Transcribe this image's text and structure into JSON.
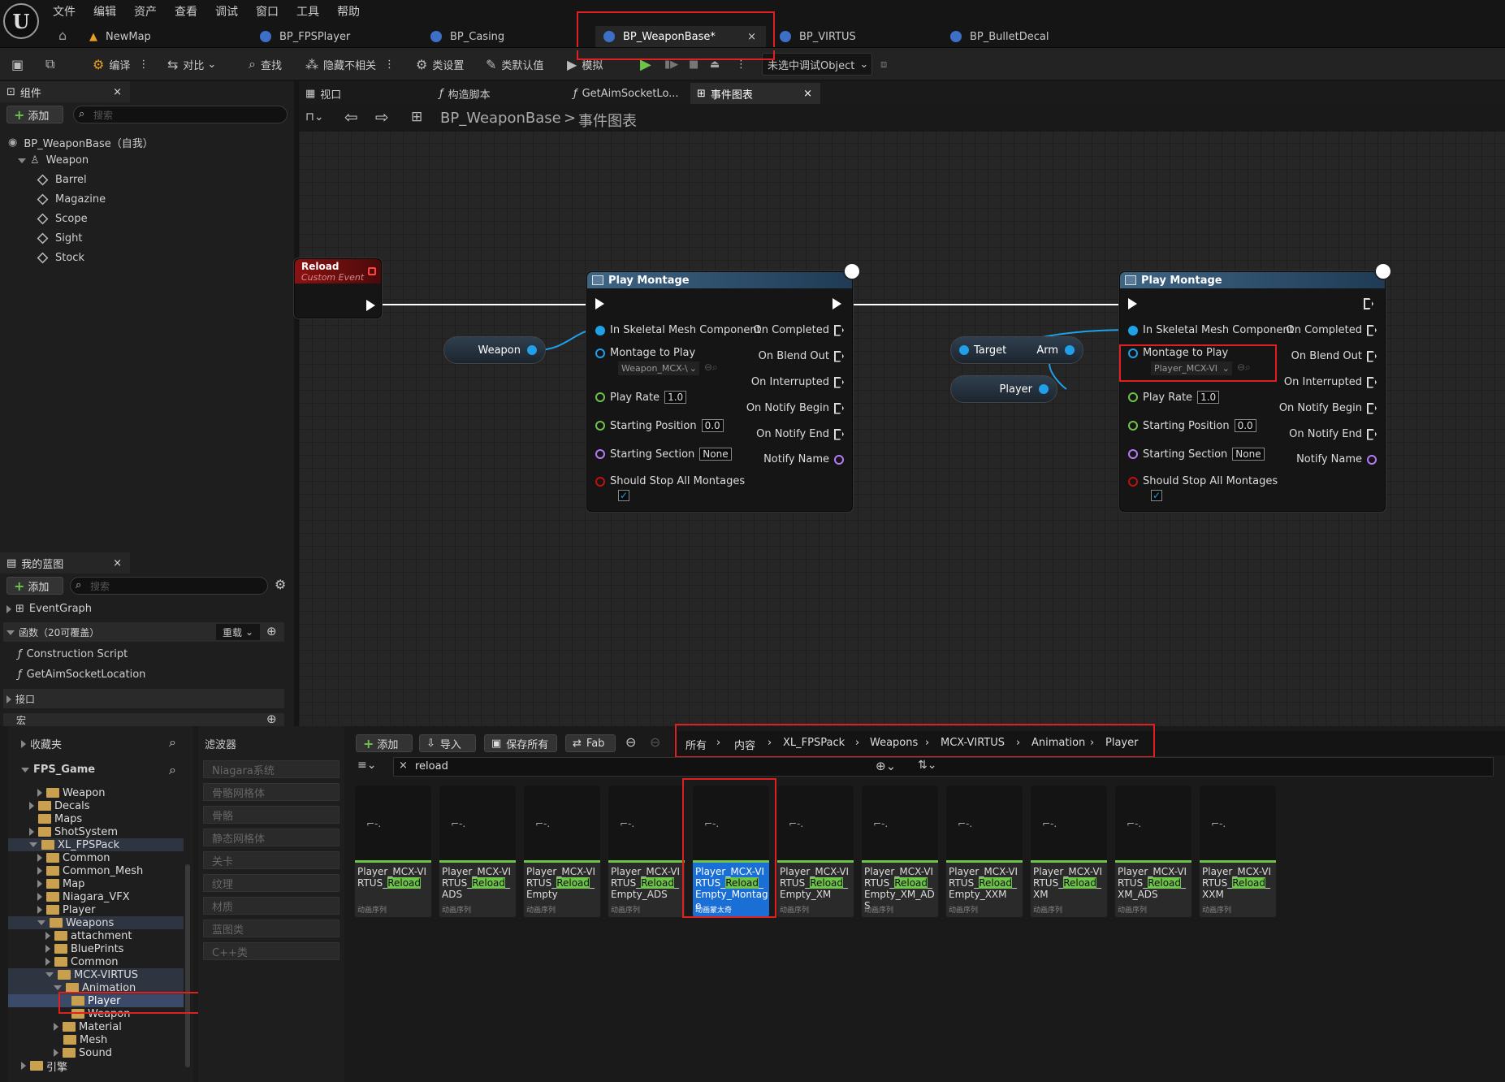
{
  "menu": [
    "文件",
    "编辑",
    "资产",
    "查看",
    "调试",
    "窗口",
    "工具",
    "帮助"
  ],
  "doc_tabs": [
    "NewMap",
    "BP_FPSPlayer",
    "BP_Casing",
    "BP_WeaponBase*",
    "BP_VIRTUS",
    "BP_BulletDecal"
  ],
  "toolbar": {
    "compile": "编译",
    "diff": "对比",
    "find": "查找",
    "hide_unrelated": "隐藏不相关",
    "class_settings": "类设置",
    "class_defaults": "类默认值",
    "simulate": "模拟",
    "debug_object": "未选中调试Object"
  },
  "components": {
    "tab": "组件",
    "add": "添加",
    "search_placeholder": "搜索",
    "root": "BP_WeaponBase（自我）",
    "weapon": "Weapon",
    "children": [
      "Barrel",
      "Magazine",
      "Scope",
      "Sight",
      "Stock"
    ]
  },
  "graph_tabs": [
    "视口",
    "构造脚本",
    "GetAimSocketLo...",
    "事件图表"
  ],
  "graph_breadcrumb": {
    "bp": "BP_WeaponBase",
    "sep": ">",
    "graph": "事件图表"
  },
  "event_node": {
    "title": "Reload",
    "subtitle": "Custom Event"
  },
  "play_montage_1": {
    "title": "Play Montage",
    "inputs": {
      "mesh": "In Skeletal Mesh Component",
      "montage": "Montage to Play",
      "montage_value": "Weapon_MCX-\\",
      "rate": "Play Rate",
      "rate_value": "1.0",
      "start_pos": "Starting Position",
      "start_pos_value": "0.0",
      "start_section": "Starting Section",
      "start_section_value": "None",
      "stop_all": "Should Stop All Montages"
    },
    "outputs": [
      "On Completed",
      "On Blend Out",
      "On Interrupted",
      "On Notify Begin",
      "On Notify End",
      "Notify Name"
    ]
  },
  "play_montage_2": {
    "title": "Play Montage",
    "inputs": {
      "mesh": "In Skeletal Mesh Component",
      "montage": "Montage to Play",
      "montage_value": "Player_MCX-VI",
      "rate": "Play Rate",
      "rate_value": "1.0",
      "start_pos": "Starting Position",
      "start_pos_value": "0.0",
      "start_section": "Starting Section",
      "start_section_value": "None",
      "stop_all": "Should Stop All Montages"
    },
    "outputs": [
      "On Completed",
      "On Blend Out",
      "On Interrupted",
      "On Notify Begin",
      "On Notify End",
      "Notify Name"
    ]
  },
  "var_nodes": {
    "weapon": "Weapon",
    "target": "Target",
    "arm": "Arm",
    "player": "Player"
  },
  "my_blueprint": {
    "tab": "我的蓝图",
    "add": "添加",
    "search_placeholder": "搜索",
    "event_graph": "EventGraph",
    "functions_header": "函数（20可覆盖）",
    "override": "重载",
    "functions": [
      "Construction Script",
      "GetAimSocketLocation"
    ],
    "interfaces": "接口",
    "macros": "宏"
  },
  "content_browser": {
    "favorites": "收藏夹",
    "project": "FPS_Game",
    "filters": "滤波器",
    "filter_items": [
      "Niagara系统",
      "骨骼网格体",
      "骨骼",
      "静态网格体",
      "关卡",
      "纹理",
      "材质",
      "蓝图类",
      "C++类"
    ],
    "folders": [
      "Weapon",
      "Decals",
      "Maps",
      "ShotSystem",
      "XL_FPSPack",
      "Common",
      "Common_Mesh",
      "Map",
      "Niagara_VFX",
      "Player",
      "Weapons",
      "attachment",
      "BluePrints",
      "Common",
      "MCX-VIRTUS",
      "Animation",
      "Player",
      "Weapon",
      "Material",
      "Mesh",
      "Sound",
      "引擎"
    ],
    "add": "添加",
    "import": "导入",
    "save_all": "保存所有",
    "fab": "Fab",
    "path": [
      "所有",
      "内容",
      "XL_FPSPack",
      "Weapons",
      "MCX-VIRTUS",
      "Animation",
      "Player"
    ],
    "search_value": "reload",
    "assets": [
      {
        "a": "Player_MCX-VIRTUS_",
        "hl": "Reload",
        "b": "",
        "type": "动画序列"
      },
      {
        "a": "Player_MCX-VIRTUS_",
        "hl": "Reload",
        "b": "_ADS",
        "type": "动画序列"
      },
      {
        "a": "Player_MCX-VIRTUS_",
        "hl": "Reload",
        "b": "_Empty",
        "type": "动画序列"
      },
      {
        "a": "Player_MCX-VIRTUS_",
        "hl": "Reload",
        "b": "_Empty_ADS",
        "type": "动画序列"
      },
      {
        "a": "Player_MCX-VIRTUS_",
        "hl": "Reload",
        "b": "_Empty_Montage",
        "type": "动画蒙太奇"
      },
      {
        "a": "Player_MCX-VIRTUS_",
        "hl": "Reload",
        "b": "_Empty_XM",
        "type": "动画序列"
      },
      {
        "a": "Player_MCX-VIRTUS_",
        "hl": "Reload",
        "b": "_Empty_XM_ADS",
        "type": "动画序列"
      },
      {
        "a": "Player_MCX-VIRTUS_",
        "hl": "Reload",
        "b": "_Empty_XXM",
        "type": "动画序列"
      },
      {
        "a": "Player_MCX-VIRTUS_",
        "hl": "Reload",
        "b": "_XM",
        "type": "动画序列"
      },
      {
        "a": "Player_MCX-VIRTUS_",
        "hl": "Reload",
        "b": "_XM_ADS",
        "type": "动画序列"
      },
      {
        "a": "Player_MCX-VIRTUS_",
        "hl": "Reload",
        "b": "_XXM",
        "type": "动画序列"
      }
    ]
  },
  "colors": {
    "exec": "#ffffff",
    "object_pin": "#1fa0e8",
    "float_pin": "#6ec44a",
    "name_pin": "#b57bf5",
    "bool_pin": "#c01010",
    "highlight": "#e02020",
    "search_hl": "#6ec44a"
  }
}
